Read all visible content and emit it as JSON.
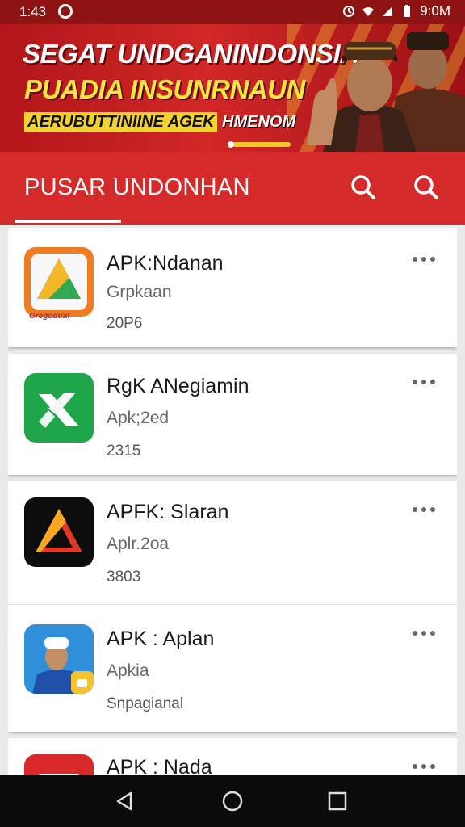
{
  "status_bar": {
    "time": "1:43",
    "battery_time": "9:0M",
    "icons": [
      "notification-icon",
      "sync-icon",
      "wifi-icon",
      "signal-icon",
      "battery-icon"
    ]
  },
  "banner": {
    "line1": "SEGAT UNDGANINDONSIAI",
    "line2": "PUADIA INSUNRNAUN",
    "line3_tag": "AERUBUTTINIINE AGEK",
    "line3_text": "HMENOM",
    "colors": {
      "line2": "#f5e642",
      "background": "#c81f22"
    }
  },
  "app_bar": {
    "title": "PUSAR UNDONHAN",
    "icons": [
      "search-icon",
      "search-icon"
    ],
    "accent": "#d52a2a"
  },
  "apps": [
    {
      "name": "APK:Ndanan",
      "subtitle": "Grpkaan",
      "meta": "20P6",
      "icon": "triangle-logo-orange",
      "icon_caption": "Gregoduat"
    },
    {
      "name": "RgK ANegiamin",
      "subtitle": "Apk;2ed",
      "meta": "2315",
      "icon": "x-logo-green"
    },
    {
      "name": "APFK: Slaran",
      "subtitle": "Aplr.2oa",
      "meta": "3803",
      "icon": "triangle-logo-black"
    },
    {
      "name": "APK : Aplan",
      "subtitle": "Apkia",
      "meta": "Snpagianal",
      "icon": "person-avatar-blue"
    },
    {
      "name": "APK : Nada",
      "subtitle": "",
      "meta": "",
      "icon": "red-logo"
    }
  ],
  "nav_bar": {
    "buttons": [
      "back-icon",
      "home-icon",
      "recents-icon"
    ]
  }
}
